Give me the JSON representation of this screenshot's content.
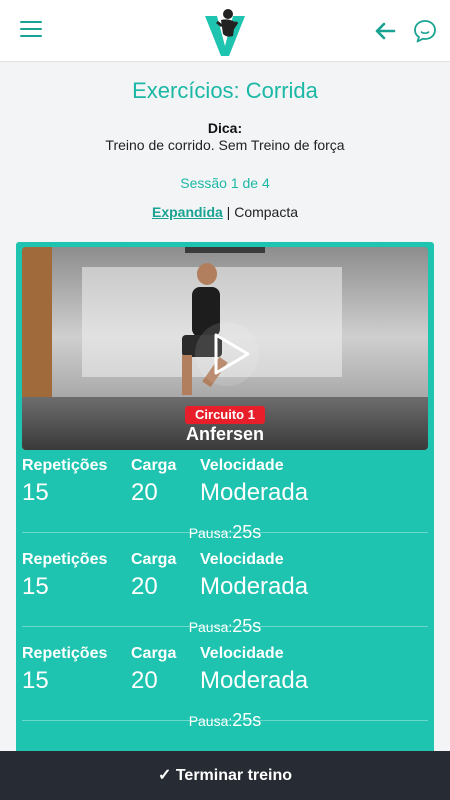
{
  "header": {
    "menu_icon": "hamburger-menu-icon",
    "logo_icon": "v-fitness-logo-icon",
    "back_icon": "arrow-left-icon",
    "chat_icon": "chat-bubble-icon",
    "accent_color": "#1aa392"
  },
  "page": {
    "title": "Exercícios: Corrida",
    "tip_label": "Dica:",
    "tip_text": "Treino de corrido. Sem Treino de força",
    "session": "Sessão 1 de 4",
    "view_expand": "Expandida",
    "view_separator": " | ",
    "view_compact": "Compacta"
  },
  "exercise": {
    "circuit": "Circuito 1",
    "name": "Anfersen",
    "play_icon": "play-icon",
    "card_color": "#1ec4af",
    "badge_color": "#e81f2a",
    "sets": [
      {
        "rep_label": "Repetições",
        "rep_value": "15",
        "load_label": "Carga",
        "load_value": "20",
        "speed_label": "Velocidade",
        "speed_value": "Moderada",
        "rest_label": "Pausa:",
        "rest_value": "25s"
      },
      {
        "rep_label": "Repetições",
        "rep_value": "15",
        "load_label": "Carga",
        "load_value": "20",
        "speed_label": "Velocidade",
        "speed_value": "Moderada",
        "rest_label": "Pausa:",
        "rest_value": "25s"
      },
      {
        "rep_label": "Repetições",
        "rep_value": "15",
        "load_label": "Carga",
        "load_value": "20",
        "speed_label": "Velocidade",
        "speed_value": "Moderada",
        "rest_label": "Pausa:",
        "rest_value": "25s"
      }
    ]
  },
  "footer": {
    "finish_label": "✓ Terminar treino",
    "bar_color": "#272b33"
  }
}
